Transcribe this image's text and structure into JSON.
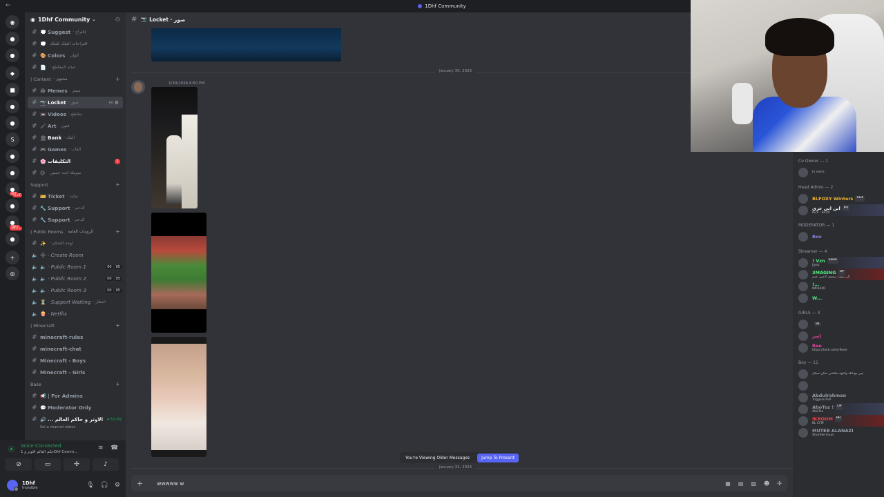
{
  "window": {
    "title": "1Dhf Community"
  },
  "servers": [
    {
      "icon": "discord-icon",
      "label": "◉"
    },
    {
      "icon": "server",
      "label": "●"
    },
    {
      "icon": "server",
      "label": "●"
    },
    {
      "icon": "server",
      "label": "◆"
    },
    {
      "icon": "server",
      "label": "■"
    },
    {
      "icon": "server",
      "label": "●"
    },
    {
      "icon": "server",
      "label": "●"
    },
    {
      "icon": "server",
      "label": "S"
    },
    {
      "icon": "server",
      "label": "●"
    },
    {
      "icon": "server",
      "label": "●"
    },
    {
      "icon": "server",
      "label": "●",
      "badge": "367"
    },
    {
      "icon": "server",
      "label": "●"
    },
    {
      "icon": "server",
      "label": "●",
      "badge": "18K+"
    },
    {
      "icon": "server",
      "label": "●"
    },
    {
      "icon": "add-server",
      "label": "+"
    },
    {
      "icon": "explore",
      "label": "◎"
    }
  ],
  "guild": {
    "name": "1Dhf Community"
  },
  "channels": [
    {
      "type": "text",
      "emoji": "💭",
      "name": "Suggest",
      "ar": "· إقتراح"
    },
    {
      "type": "text",
      "emoji": "💭",
      "name": "",
      "ar": "اقتراحات الملك للملك"
    },
    {
      "type": "text",
      "emoji": "🎨",
      "name": "Colors",
      "ar": "· الوان"
    },
    {
      "type": "text",
      "emoji": "📄",
      "name": "",
      "ar": "· امثله المقاطع"
    },
    {
      "type": "category",
      "name": "| Content",
      "ar": "· محتوى"
    },
    {
      "type": "text",
      "emoji": "😂",
      "name": "Memes",
      "ar": "· ميمز"
    },
    {
      "type": "text",
      "emoji": "📷",
      "name": "Locket",
      "ar": "· صور",
      "active": true
    },
    {
      "type": "text",
      "emoji": "📼",
      "name": "Videos",
      "ar": "· مقاطع"
    },
    {
      "type": "text",
      "emoji": "🖌",
      "name": "Art",
      "ar": "· فنون"
    },
    {
      "type": "text",
      "emoji": "🏛",
      "name": "Bank",
      "ar": "· البنك",
      "bright": true
    },
    {
      "type": "text",
      "emoji": "🎮",
      "name": "Games",
      "ar": "· العاب"
    },
    {
      "type": "text",
      "emoji": "🌸",
      "name": "التكليفات",
      "ar": "",
      "bright": true,
      "badge": "1"
    },
    {
      "type": "text",
      "emoji": "😊",
      "name": "",
      "ar": "سويتك-انت-حسين"
    },
    {
      "type": "category",
      "name": "Support",
      "ar": ""
    },
    {
      "type": "text",
      "emoji": "🎫",
      "name": "Ticket",
      "ar": "· تيكت"
    },
    {
      "type": "text",
      "emoji": "🔧",
      "name": "Support",
      "ar": "· الدعم"
    },
    {
      "type": "text",
      "emoji": "🔧",
      "name": "Support",
      "ar": "· الدعم"
    },
    {
      "type": "category",
      "name": "| Public Rooms",
      "ar": "· الرومات العامة"
    },
    {
      "type": "text",
      "emoji": "✨",
      "name": "",
      "ar": "· لوحة التحكم"
    },
    {
      "type": "voice",
      "emoji": "➕",
      "name": "· Create Room",
      "ar": ""
    },
    {
      "type": "voice",
      "emoji": "🔈",
      "name": "· Public Room 1",
      "ar": "",
      "cnt": [
        "00",
        "05"
      ]
    },
    {
      "type": "voice",
      "emoji": "🔈",
      "name": "· Public Room 2",
      "ar": "",
      "cnt": [
        "00",
        "05"
      ]
    },
    {
      "type": "voice",
      "emoji": "🔈",
      "name": "· Public Room 3",
      "ar": "",
      "cnt": [
        "00",
        "05"
      ]
    },
    {
      "type": "voice",
      "emoji": "⏳",
      "name": "· Support Waiting",
      "ar": "· انتظار"
    },
    {
      "type": "voice",
      "emoji": "🍿",
      "name": "· Netflix",
      "ar": ""
    },
    {
      "type": "category",
      "name": "| Minecraft",
      "ar": ""
    },
    {
      "type": "plain",
      "emoji": "",
      "name": "minecraft-rules",
      "ar": ""
    },
    {
      "type": "plain",
      "emoji": "",
      "name": "minecraft-chat",
      "ar": ""
    },
    {
      "type": "plain",
      "emoji": "",
      "name": "Minecraft - Boys",
      "ar": ""
    },
    {
      "type": "plain",
      "emoji": "",
      "name": "Minecraft - Girls",
      "ar": ""
    },
    {
      "type": "category",
      "name": "Base",
      "ar": ""
    },
    {
      "type": "text",
      "emoji": "📢",
      "name": "| For Admins",
      "ar": ""
    },
    {
      "type": "text",
      "emoji": "💬",
      "name": "Moderator Only",
      "ar": ""
    },
    {
      "type": "text",
      "emoji": "🔊",
      "name": "... الاوتر و حاكم العالم",
      "ar": "",
      "right": "4:53:09",
      "bright": true
    }
  ],
  "status_hint": "Set a channel status",
  "voice": {
    "title": "Voice Connected",
    "sub": "حكم العالم الاوتر و 1Dhf Comm..."
  },
  "user": {
    "name": "1Dhf",
    "status": "Invisible"
  },
  "header": {
    "channel_emoji": "📷",
    "channel_name": "Locket · صور"
  },
  "messages": {
    "date1": "January 30, 2026",
    "author": "",
    "time": "1/30/2026 6:50 PM",
    "date2": "January 31, 2026"
  },
  "older_banner": {
    "text": "You're Viewing Older Messages",
    "jump": "Jump To Present"
  },
  "composer": {
    "text": "wwwww w"
  },
  "members": [
    {
      "role": "Co Owner — 1",
      "list": [
        {
          "name": "",
          "status": "In voice",
          "color": "#f23f43",
          "style": ""
        }
      ]
    },
    {
      "role": "Head Admin — 2",
      "list": [
        {
          "name": "BLFOXY Winters",
          "status": "",
          "color": "#f0b232",
          "tag": "RGX",
          "style": ""
        },
        {
          "name": "ابن ابي عزي",
          "status": "Kick : BFOX",
          "color": "#f2f3f5",
          "tag": "Joy",
          "style": "hl2"
        }
      ]
    },
    {
      "role": "MODERATOR — 1",
      "list": [
        {
          "name": "Rov",
          "status": "",
          "color": "#8b8ee0",
          "style": ""
        }
      ]
    },
    {
      "role": "Streamer — 4",
      "list": [
        {
          "name": "! Vzn",
          "status": "Jiyez",
          "color": "#57f287",
          "tag": "Swan",
          "style": "hl2"
        },
        {
          "name": "3MAGING",
          "status": "الي يموت بيسوي لاعبين عمم",
          "color": "#57f287",
          "tag": "OP",
          "style": "hl"
        },
        {
          "name": "!...",
          "status": "IMOHDO",
          "color": "#57f287",
          "style": ""
        },
        {
          "name": "W...",
          "status": "",
          "color": "#57f287",
          "style": ""
        }
      ]
    },
    {
      "role": "GIRLS — 3",
      "list": [
        {
          "name": "",
          "status": "",
          "color": "#f2f3f5",
          "tag": "94",
          "style": ""
        },
        {
          "name": "إسر",
          "status": "",
          "color": "#eb459e",
          "style": ""
        },
        {
          "name": "Ree",
          "status": "https://kick.com/rReee",
          "color": "#eb459e",
          "style": ""
        }
      ]
    },
    {
      "role": "Boy — 11",
      "list": [
        {
          "name": "",
          "status": "بيبي بيع الله ولاقوة بخلاشي سكن شيكل",
          "color": "#f23f43",
          "style": ""
        },
        {
          "name": "",
          "status": "",
          "color": "#949ba4",
          "style": ""
        },
        {
          "name": "Abdulrahman",
          "status": "Triggers PvP",
          "color": "#949ba4",
          "style": ""
        },
        {
          "name": "AboToz !",
          "status": "AboTee",
          "color": "#949ba4",
          "tag": "OP",
          "style": "hl2"
        },
        {
          "name": "IKROOM",
          "status": "BL CFM",
          "color": "#f23f43",
          "tag": "BR",
          "style": "hl"
        },
        {
          "name": "MUTEB ALANAZI",
          "status": "Stumble Guys",
          "color": "#949ba4",
          "style": ""
        }
      ]
    }
  ],
  "colors": {
    "accent": "#5865f2",
    "online": "#23a55a",
    "danger": "#f23f43"
  }
}
